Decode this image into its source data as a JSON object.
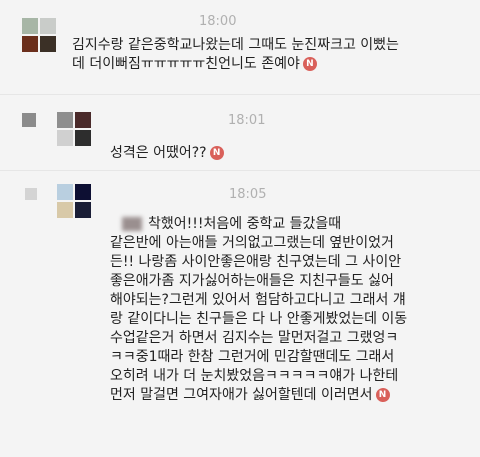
{
  "comments": [
    {
      "time": "18:00",
      "lines": [
        "김지수랑 같은중학교나왔는데 그때도 눈진짜크고 이뻤는",
        "데 더이뻐짐ㅠㅠㅠㅠㅠ친언니도 존예야"
      ],
      "avatar_colors": [
        "#a7b6a6",
        "#c9ccc9",
        "#6b2f1c",
        "#3b3026"
      ],
      "badge": "N"
    },
    {
      "time": "18:01",
      "lines": [
        "성격은 어땠어??"
      ],
      "avatar_colors": [
        "#8e8e8e",
        "#4a2a2a",
        "#d0d0d0",
        "#2d2d2d"
      ],
      "badge": "N"
    },
    {
      "time": "18:05",
      "lines": [
        "착했어!!!처음에 중학교 들갔을때",
        "같은반에 아는애들 거의없고그랬는데 옆반이었거",
        "든!! 나랑좀 사이안좋은애랑 친구였는데 그 사이안",
        "좋은애가좀 지가싫어하는애들은 지친구들도 싫어",
        "해야되는?그런게 있어서 험담하고다니고 그래서 걔",
        "랑 같이다니는 친구들은 다 나 안좋게봤었는데 이동",
        "수업같은거 하면서 김지수는 말먼저걸고 그랬엉ㅋ",
        "ㅋㅋ중1때라 한참 그런거에 민감할땐데도 그래서",
        "오히려 내가 더 눈치봤었음ㅋㅋㅋㅋㅋ얘가 나한테",
        "먼저 말걸면 그여자애가 싫어할텐데 이러면서"
      ],
      "avatar_colors": [
        "#b9cfe0",
        "#0d0f33",
        "#d8c9a8",
        "#1a1e36"
      ],
      "badge": "N"
    }
  ]
}
